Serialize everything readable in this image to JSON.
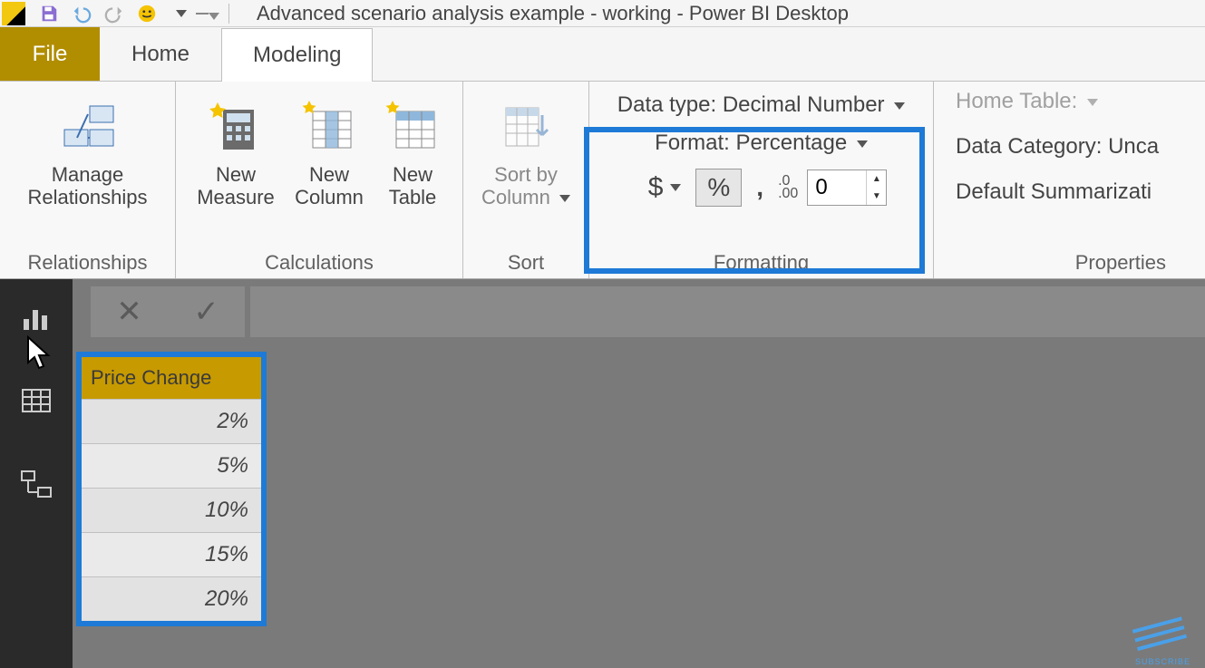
{
  "title": "Advanced scenario analysis example - working - Power BI Desktop",
  "tabs": {
    "file": "File",
    "home": "Home",
    "modeling": "Modeling"
  },
  "ribbon": {
    "relationships": {
      "manage": "Manage Relationships",
      "title": "Relationships"
    },
    "calculations": {
      "measure": "New Measure",
      "column": "New Column",
      "table": "New Table",
      "title": "Calculations"
    },
    "sort": {
      "button": "Sort by Column",
      "title": "Sort"
    },
    "formatting": {
      "datatype_label": "Data type: Decimal Number",
      "format_label": "Format: Percentage",
      "dollar": "$",
      "percent": "%",
      "comma": ",",
      "decimal_icon": ".0\n.00",
      "decimal_value": "0",
      "title": "Formatting"
    },
    "properties": {
      "home_table": "Home Table:",
      "data_category": "Data Category: Unca",
      "default_sum": "Default Summarizati",
      "title": "Properties"
    }
  },
  "formula_bar": {
    "cancel": "✕",
    "confirm": "✓"
  },
  "views": {
    "report": "report",
    "data": "data",
    "model": "model"
  },
  "table": {
    "header": "Price Change",
    "rows": [
      "2%",
      "5%",
      "10%",
      "15%",
      "20%"
    ]
  },
  "subscribe": "SUBSCRIBE"
}
